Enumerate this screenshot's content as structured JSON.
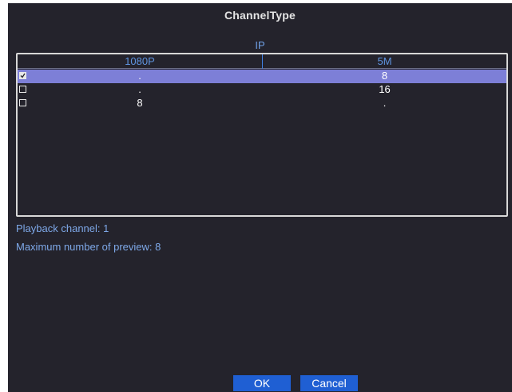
{
  "dialog": {
    "title": "ChannelType",
    "section_label": "IP"
  },
  "table": {
    "columns": [
      "1080P",
      "5M"
    ],
    "rows": [
      {
        "checked": true,
        "selected": true,
        "values": [
          ".",
          "8"
        ]
      },
      {
        "checked": false,
        "selected": false,
        "values": [
          ".",
          "16"
        ]
      },
      {
        "checked": false,
        "selected": false,
        "values": [
          "8",
          "."
        ]
      }
    ]
  },
  "info": {
    "playback": "Playback channel: 1",
    "max_preview": "Maximum number of preview: 8"
  },
  "buttons": {
    "ok": "OK",
    "cancel": "Cancel"
  },
  "colors": {
    "background": "#24232c",
    "selection": "#7d7fd7",
    "accent": "#1f5fd3",
    "label_text": "#7ea8e8"
  }
}
